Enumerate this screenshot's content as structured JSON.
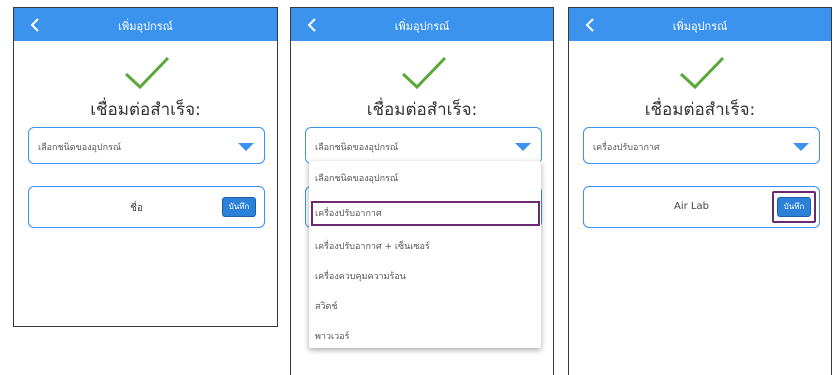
{
  "header": {
    "title": "เพิ่มอุปกรณ์"
  },
  "success_text": "เชื่อมต่อสำเร็จ:",
  "panels": [
    {
      "dropdown_value": "เลือกชนิดของอุปกรณ์",
      "name_value": "ชื่อ",
      "save_label": "บันทึก"
    },
    {
      "dropdown_value": "เลือกชนิดของอุปกรณ์"
    },
    {
      "dropdown_value": "เครื่องปรับอากาศ",
      "name_value": "Air Lab",
      "save_label": "บันทึก"
    }
  ],
  "menu": {
    "items": [
      "เลือกชนิดของอุปกรณ์",
      "เครื่องปรับอากาศ",
      "เครื่องปรับอากาศ + เซ็นเซอร์",
      "เครื่องควบคุมความร้อน",
      "สวิตช์",
      "พาวเวอร์"
    ],
    "selected_index": 1
  },
  "colors": {
    "header": "#3b93ee",
    "accent": "#3b93ee",
    "highlight": "#6a2a72",
    "button": "#2b80d8"
  }
}
